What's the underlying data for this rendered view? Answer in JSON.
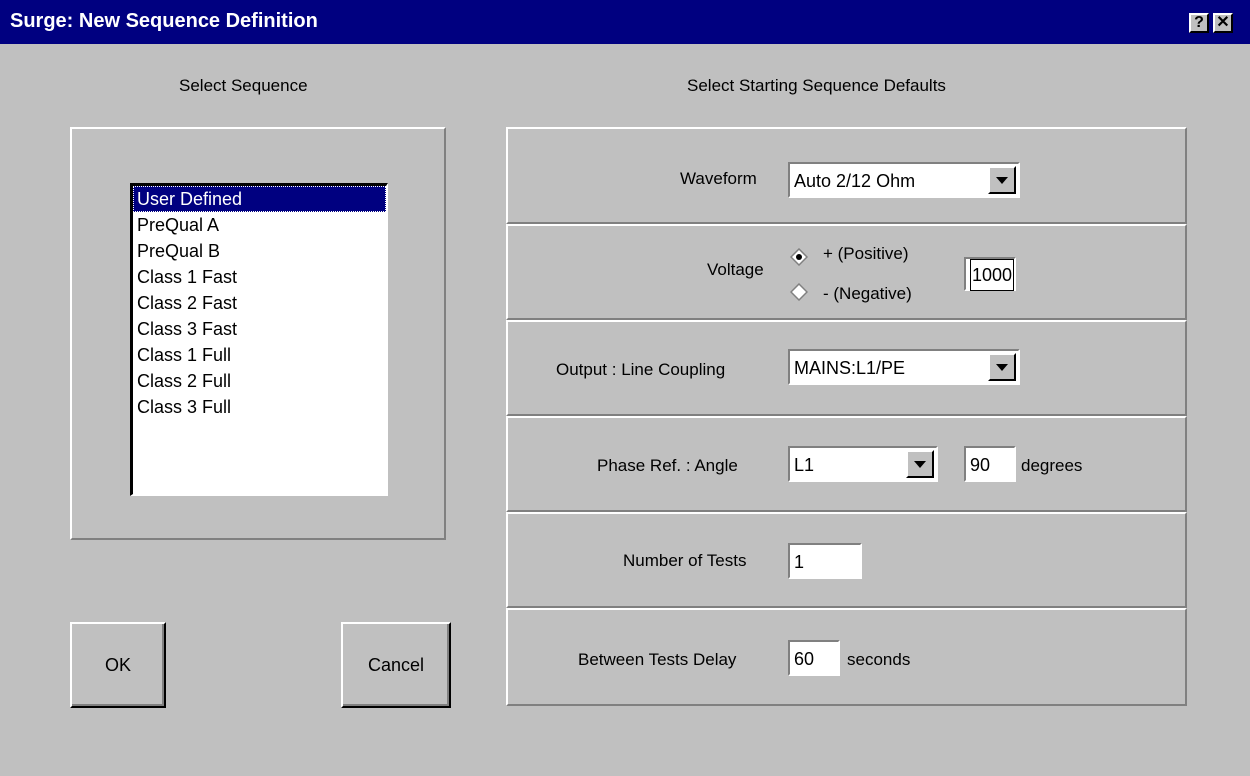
{
  "window": {
    "title": "Surge: New Sequence Definition",
    "help_glyph": "?",
    "close_glyph": "✕"
  },
  "left": {
    "heading": "Select Sequence",
    "sequences": [
      "User Defined",
      "PreQual A",
      "PreQual B",
      "Class 1 Fast",
      "Class 2 Fast",
      "Class 3 Fast",
      "Class 1 Full",
      "Class 2 Full",
      "Class 3 Full"
    ],
    "selected": "User Defined"
  },
  "right": {
    "heading": "Select Starting Sequence Defaults",
    "waveform": {
      "label": "Waveform",
      "value": "Auto 2/12 Ohm"
    },
    "voltage": {
      "label": "Voltage",
      "positive": "+ (Positive)",
      "negative": "- (Negative)",
      "selected": "positive",
      "value": "1000"
    },
    "coupling": {
      "label": "Output : Line Coupling",
      "value": "MAINS:L1/PE"
    },
    "phase": {
      "label": "Phase Ref. : Angle",
      "ref": "L1",
      "angle": "90",
      "unit": "degrees"
    },
    "tests": {
      "label": "Number of Tests",
      "value": "1"
    },
    "delay": {
      "label": "Between Tests Delay",
      "value": "60",
      "unit": "seconds"
    }
  },
  "buttons": {
    "ok": "OK",
    "cancel": "Cancel"
  },
  "colors": {
    "face": "#c0c0c0",
    "titlebar": "#000080",
    "selection": "#000080"
  }
}
